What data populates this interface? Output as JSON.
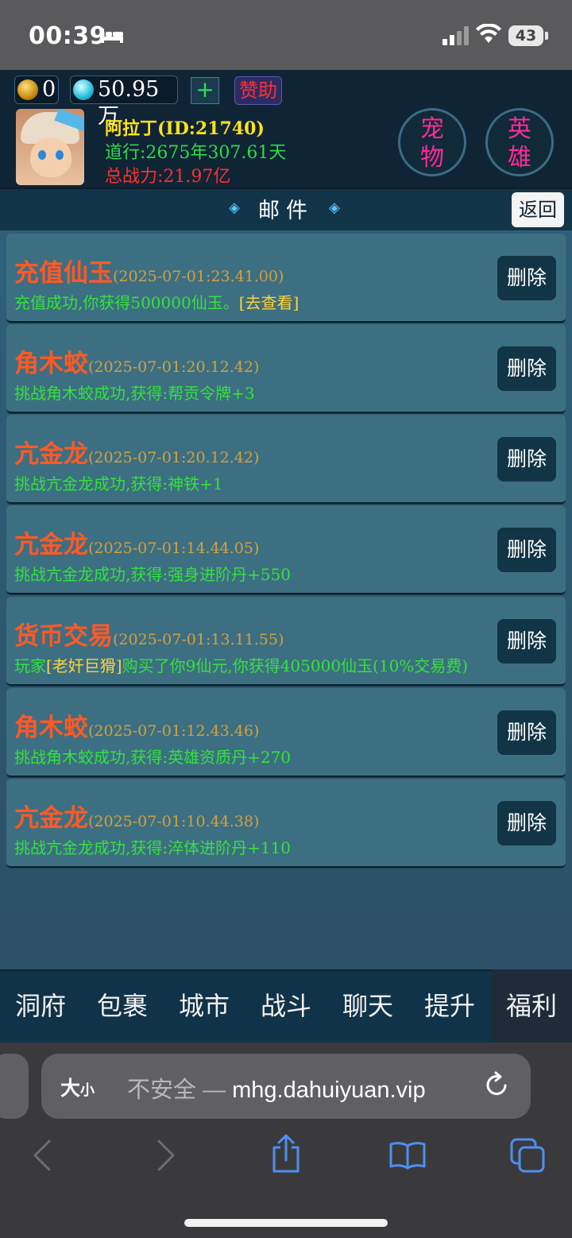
{
  "status_bar": {
    "time": "00:39",
    "battery": "43"
  },
  "top": {
    "gold": "0",
    "jade": "50.95万",
    "plus_label": "+",
    "sponsor_label": "赞助",
    "player_name": "阿拉丁(ID:21740)",
    "daoxing": "道行:2675年307.61天",
    "power": "总战力:21.97亿",
    "pet_line1": "宠",
    "pet_line2": "物",
    "hero_line1": "英",
    "hero_line2": "雄"
  },
  "mail_header": {
    "title": "邮件",
    "back_label": "返回"
  },
  "mails": [
    {
      "name": "充值仙玉",
      "time": "(2025-07-01:23.41.00)",
      "body": "充值成功,你获得500000仙玉。",
      "link": "[去查看]",
      "delete": "删除"
    },
    {
      "name": "角木蛟",
      "time": "(2025-07-01:20.12.42)",
      "body": "挑战角木蛟成功,获得:帮贡令牌+3",
      "delete": "删除"
    },
    {
      "name": "亢金龙",
      "time": "(2025-07-01:20.12.42)",
      "body": "挑战亢金龙成功,获得:神铁+1",
      "delete": "删除"
    },
    {
      "name": "亢金龙",
      "time": "(2025-07-01:14.44.05)",
      "body": "挑战亢金龙成功,获得:强身进阶丹+550",
      "delete": "删除"
    },
    {
      "name": "货币交易",
      "time": "(2025-07-01:13.11.55)",
      "body_pre": "玩家",
      "link": "[老奸巨猾]",
      "body_post": "购买了你9仙元,你获得405000仙玉(10%交易费)",
      "delete": "删除"
    },
    {
      "name": "角木蛟",
      "time": "(2025-07-01:12.43.46)",
      "body": "挑战角木蛟成功,获得:英雄资质丹+270",
      "delete": "删除"
    },
    {
      "name": "亢金龙",
      "time": "(2025-07-01:10.44.38)",
      "body": "挑战亢金龙成功,获得:淬体进阶丹+110",
      "delete": "删除"
    }
  ],
  "tabs": [
    "洞府",
    "包裹",
    "城市",
    "战斗",
    "聊天",
    "提升",
    "福利"
  ],
  "active_tab": "福利",
  "browser": {
    "aa_big": "大",
    "aa_small": "小",
    "insecure": "不安全",
    "dash": " — ",
    "domain": "mhg.dahuiyuan.vip"
  }
}
